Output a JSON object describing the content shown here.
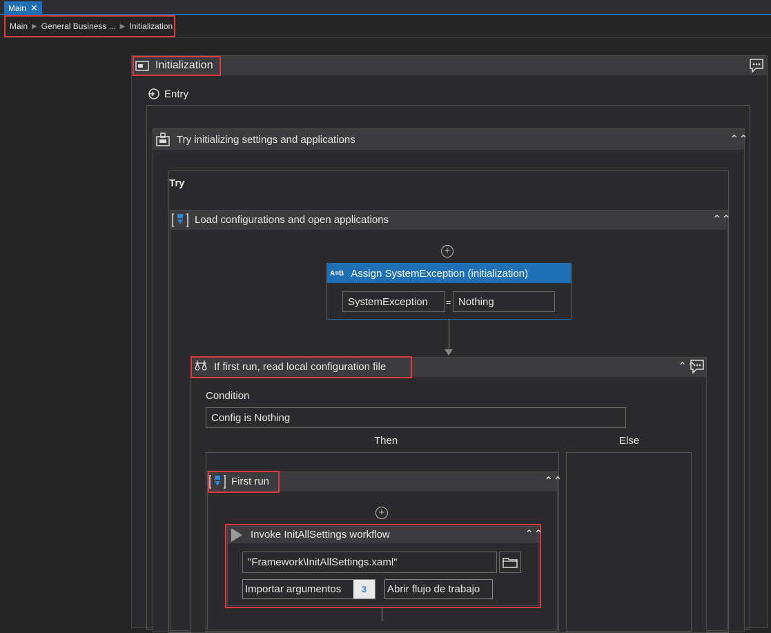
{
  "tabs": [
    {
      "label": "Main",
      "close": "✕"
    }
  ],
  "breadcrumb": [
    "Main",
    "General Business ...",
    "Initialization"
  ],
  "state": {
    "title": "Initialization",
    "entry_label": "Entry"
  },
  "try_catch": {
    "title": "Try initializing settings and applications",
    "try_label": "Try"
  },
  "sequence": {
    "title": "Load configurations and open applications"
  },
  "assign": {
    "title": "Assign SystemException (initialization)",
    "badge": "A=B",
    "to": "SystemException",
    "equals": "=",
    "value": "Nothing"
  },
  "if_activity": {
    "title": "If first run, read local configuration file",
    "condition_label": "Condition",
    "condition": "Config is Nothing",
    "then_label": "Then",
    "else_label": "Else"
  },
  "first_run": {
    "title": "First run"
  },
  "invoke": {
    "title": "Invoke InitAllSettings workflow",
    "path": "\"Framework\\InitAllSettings.xaml\"",
    "import_label": "Importar argumentos",
    "import_count": "3",
    "open_label": "Abrir flujo de trabajo"
  },
  "colors": {
    "accent": "#1f6fb5",
    "highlight": "#e0393e",
    "badge": "#2f86d6"
  }
}
